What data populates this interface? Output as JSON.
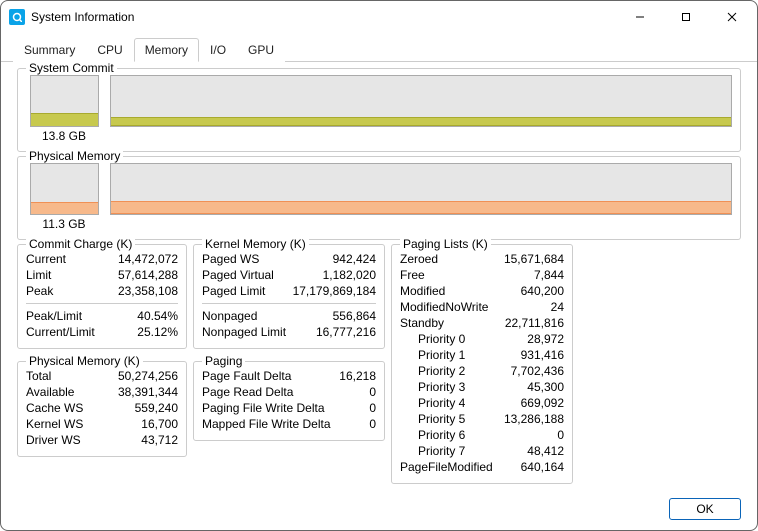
{
  "window": {
    "title": "System Information"
  },
  "tabs": [
    "Summary",
    "CPU",
    "Memory",
    "I/O",
    "GPU"
  ],
  "active_tab": 2,
  "colors": {
    "commit_fill": "#c7c94e",
    "commit_line": "#a8aa2e",
    "phys_fill": "#f7b98b",
    "phys_line": "#f09055"
  },
  "graphs": {
    "commit": {
      "legend": "System Commit",
      "caption": "13.8 GB",
      "thumb_pct": 25,
      "band_bottom_pct": 0,
      "band_height_pct": 14
    },
    "phys": {
      "legend": "Physical Memory",
      "caption": "11.3 GB",
      "thumb_pct": 22,
      "band_bottom_pct": 0,
      "band_height_pct": 22
    }
  },
  "commit_charge": {
    "legend": "Commit Charge (K)",
    "rows": [
      {
        "k": "Current",
        "v": "14,472,072"
      },
      {
        "k": "Limit",
        "v": "57,614,288"
      },
      {
        "k": "Peak",
        "v": "23,358,108"
      }
    ],
    "ratios": [
      {
        "k": "Peak/Limit",
        "v": "40.54%"
      },
      {
        "k": "Current/Limit",
        "v": "25.12%"
      }
    ]
  },
  "physical_memory": {
    "legend": "Physical Memory (K)",
    "rows": [
      {
        "k": "Total",
        "v": "50,274,256"
      },
      {
        "k": "Available",
        "v": "38,391,344"
      },
      {
        "k": "Cache WS",
        "v": "559,240"
      },
      {
        "k": "Kernel WS",
        "v": "16,700"
      },
      {
        "k": "Driver WS",
        "v": "43,712"
      }
    ]
  },
  "kernel_memory": {
    "legend": "Kernel Memory (K)",
    "rows": [
      {
        "k": "Paged WS",
        "v": "942,424"
      },
      {
        "k": "Paged Virtual",
        "v": "1,182,020"
      },
      {
        "k": "Paged Limit",
        "v": "17,179,869,184"
      }
    ],
    "rows2": [
      {
        "k": "Nonpaged",
        "v": "556,864"
      },
      {
        "k": "Nonpaged Limit",
        "v": "16,777,216"
      }
    ]
  },
  "paging": {
    "legend": "Paging",
    "rows": [
      {
        "k": "Page Fault Delta",
        "v": "16,218"
      },
      {
        "k": "Page Read Delta",
        "v": "0"
      },
      {
        "k": "Paging File Write Delta",
        "v": "0"
      },
      {
        "k": "Mapped File Write Delta",
        "v": "0"
      }
    ]
  },
  "paging_lists": {
    "legend": "Paging Lists (K)",
    "rows_top": [
      {
        "k": "Zeroed",
        "v": "15,671,684"
      },
      {
        "k": "Free",
        "v": "7,844"
      },
      {
        "k": "Modified",
        "v": "640,200"
      },
      {
        "k": "ModifiedNoWrite",
        "v": "24"
      },
      {
        "k": "Standby",
        "v": "22,711,816"
      }
    ],
    "priorities": [
      {
        "k": "Priority 0",
        "v": "28,972"
      },
      {
        "k": "Priority 1",
        "v": "931,416"
      },
      {
        "k": "Priority 2",
        "v": "7,702,436"
      },
      {
        "k": "Priority 3",
        "v": "45,300"
      },
      {
        "k": "Priority 4",
        "v": "669,092"
      },
      {
        "k": "Priority 5",
        "v": "13,286,188"
      },
      {
        "k": "Priority 6",
        "v": "0"
      },
      {
        "k": "Priority 7",
        "v": "48,412"
      }
    ],
    "rows_bottom": [
      {
        "k": "PageFileModified",
        "v": "640,164"
      }
    ]
  },
  "footer": {
    "ok": "OK"
  }
}
